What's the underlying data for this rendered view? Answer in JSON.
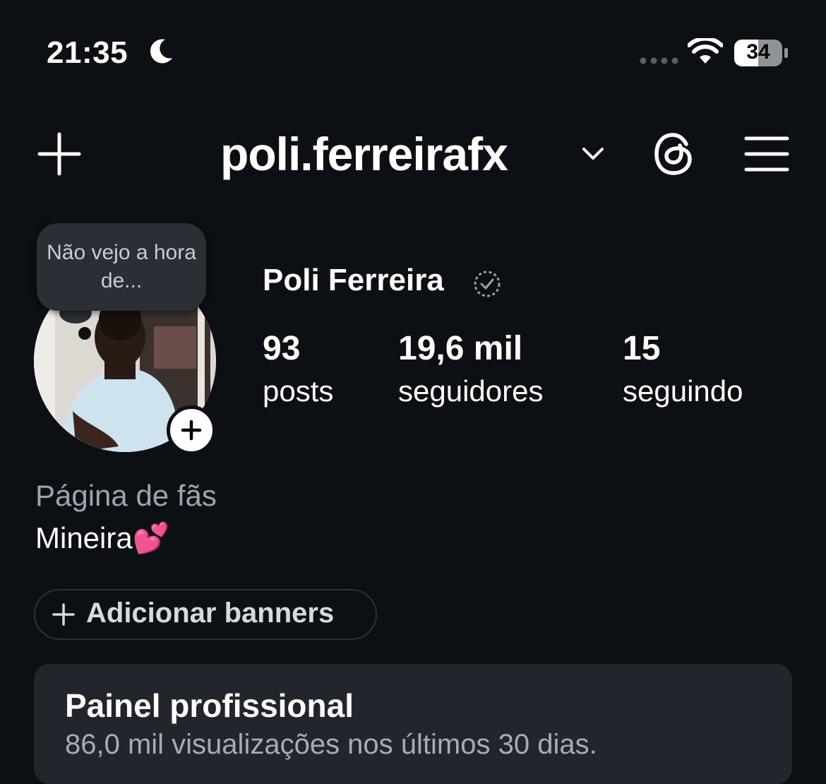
{
  "status_bar": {
    "time": "21:35",
    "battery": "34"
  },
  "header": {
    "username": "poli.ferreirafx"
  },
  "profile": {
    "note": "Não vejo a hora de...",
    "display_name": "Poli Ferreira",
    "stats": [
      {
        "value": "93",
        "label": "posts"
      },
      {
        "value": "19,6 mil",
        "label": "seguidores"
      },
      {
        "value": "15",
        "label": "seguindo"
      }
    ],
    "category": "Página de fãs",
    "bio": "Mineira💕"
  },
  "banner_button": {
    "label": "Adicionar banners"
  },
  "panel": {
    "title": "Painel profissional",
    "subtitle": "86,0 mil visualizações nos últimos 30 dias."
  },
  "colors": {
    "background": "#0c0f14",
    "panel": "#22252c",
    "muted_text": "#9ea3ad"
  },
  "icons": [
    "moon-icon",
    "signal-icon",
    "wifi-icon",
    "battery-icon",
    "plus-icon",
    "chevron-down-icon",
    "threads-icon",
    "menu-icon",
    "verified-icon"
  ]
}
